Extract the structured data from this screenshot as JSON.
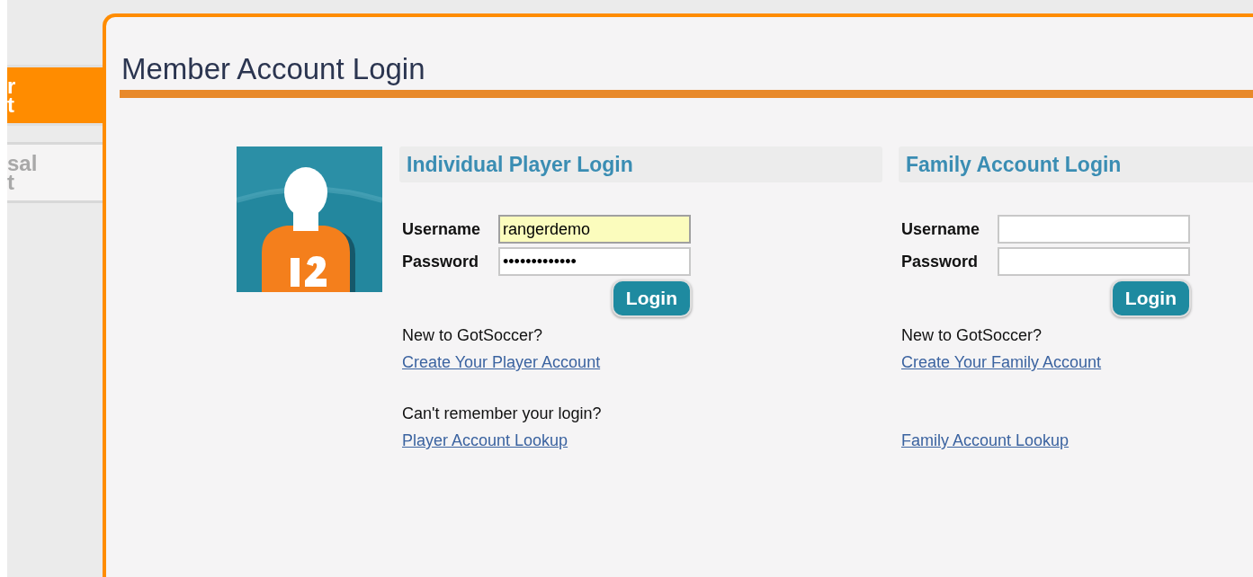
{
  "side_tabs": [
    {
      "lines": [
        "r",
        "t"
      ],
      "selected": true
    },
    {
      "lines": [
        "sal",
        "t"
      ],
      "selected": false
    }
  ],
  "title": "Member Account Login",
  "sections": [
    {
      "heading": "Individual Player Login",
      "fields": [
        {
          "label": "Username",
          "value": "rangerdemo",
          "highlighted": true
        },
        {
          "label": "Password",
          "value": "•••••••••••••",
          "highlighted": false
        }
      ],
      "button": "Login",
      "groups": [
        {
          "note": "New to GotSoccer?",
          "link": "Create Your Player Account"
        },
        {
          "note": "Can't remember your login?",
          "link": "Player Account Lookup"
        }
      ]
    },
    {
      "heading": "Family Account Login",
      "fields": [
        {
          "label": "Username",
          "highlighted": false
        },
        {
          "label": "Password",
          "highlighted": false
        }
      ],
      "button": "Login",
      "groups": [
        {
          "note": "New to GotSoccer?",
          "link": "Create Your Family Account"
        },
        {
          "link": "Family Account Lookup"
        }
      ]
    }
  ]
}
